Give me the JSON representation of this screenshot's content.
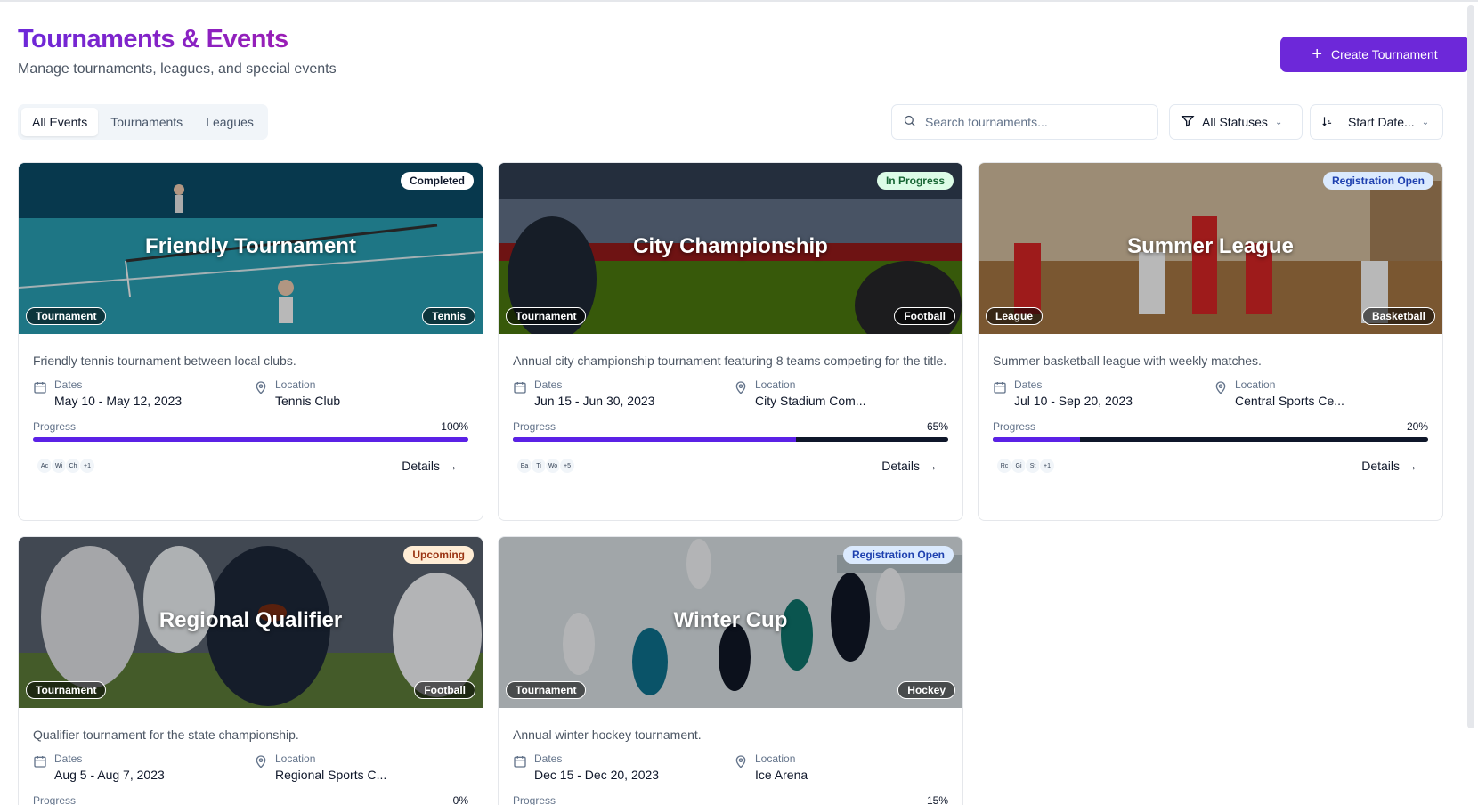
{
  "header": {
    "title": "Tournaments & Events",
    "subtitle": "Manage tournaments, leagues, and special events",
    "create_label": "Create Tournament"
  },
  "tabs": [
    "All Events",
    "Tournaments",
    "Leagues"
  ],
  "search": {
    "placeholder": "Search tournaments..."
  },
  "filters": {
    "status": "All Statuses",
    "sort": "Start Date..."
  },
  "labels": {
    "dates": "Dates",
    "location": "Location",
    "progress": "Progress",
    "details": "Details"
  },
  "cards": [
    {
      "title": "Friendly Tournament",
      "status": "Completed",
      "type": "Tournament",
      "sport": "Tennis",
      "description": "Friendly tennis tournament between local clubs.",
      "dates": "May 10 - May 12, 2023",
      "location": "Tennis Club",
      "progress_label": "100%",
      "progress": 1.0,
      "avatars": [
        "Ac",
        "Wi",
        "Ch",
        "+1"
      ],
      "status_bg": "#ffffff",
      "status_fg": "#0f172a"
    },
    {
      "title": "City Championship",
      "status": "In Progress",
      "type": "Tournament",
      "sport": "Football",
      "description": "Annual city championship tournament featuring 8 teams competing for the title.",
      "dates": "Jun 15 - Jun 30, 2023",
      "location": "City Stadium Com...",
      "progress_label": "65%",
      "progress": 0.65,
      "avatars": [
        "Ea",
        "Ti",
        "Wo",
        "+5"
      ],
      "status_bg": "#dcfce7",
      "status_fg": "#166534"
    },
    {
      "title": "Summer League",
      "status": "Registration Open",
      "type": "League",
      "sport": "Basketball",
      "description": "Summer basketball league with weekly matches.",
      "dates": "Jul 10 - Sep 20, 2023",
      "location": "Central Sports Ce...",
      "progress_label": "20%",
      "progress": 0.2,
      "avatars": [
        "Rc",
        "Gi",
        "St",
        "+1"
      ],
      "status_bg": "#dbeafe",
      "status_fg": "#1e40af"
    },
    {
      "title": "Regional Qualifier",
      "status": "Upcoming",
      "type": "Tournament",
      "sport": "Football",
      "description": "Qualifier tournament for the state championship.",
      "dates": "Aug 5 - Aug 7, 2023",
      "location": "Regional Sports C...",
      "progress_label": "0%",
      "progress": 0.0,
      "avatars": [],
      "status_bg": "#ffedd5",
      "status_fg": "#9a3412"
    },
    {
      "title": "Winter Cup",
      "status": "Registration Open",
      "type": "Tournament",
      "sport": "Hockey",
      "description": "Annual winter hockey tournament.",
      "dates": "Dec 15 - Dec 20, 2023",
      "location": "Ice Arena",
      "progress_label": "15%",
      "progress": 0.15,
      "avatars": [],
      "status_bg": "#dbeafe",
      "status_fg": "#1e40af"
    }
  ],
  "colors": {
    "accent": "#6d28d9",
    "progress": "#5b21e6"
  }
}
